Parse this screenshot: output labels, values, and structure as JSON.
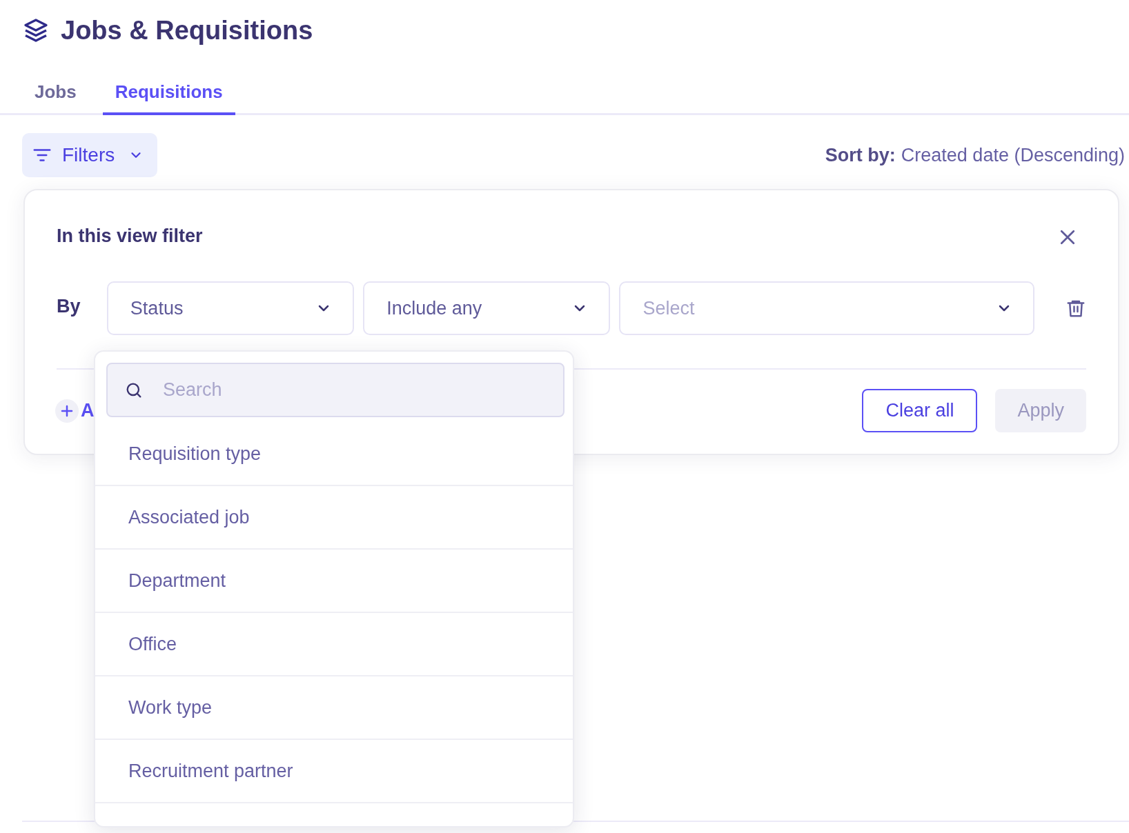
{
  "page": {
    "title": "Jobs & Requisitions"
  },
  "tabs": [
    {
      "label": "Jobs",
      "selected": false
    },
    {
      "label": "Requisitions",
      "selected": true
    }
  ],
  "toolbar": {
    "filters_button": "Filters",
    "sort_label": "Sort by:",
    "sort_value": "Created date (Descending)"
  },
  "filter_panel": {
    "title": "In this view filter",
    "row_label": "By",
    "field": "Status",
    "operator": "Include any",
    "value_placeholder": "Select",
    "add_filter_label": "A",
    "clear_button": "Clear all",
    "apply_button": "Apply",
    "apply_disabled": true
  },
  "field_dropdown": {
    "search_placeholder": "Search",
    "options": [
      "Requisition type",
      "Associated job",
      "Department",
      "Office",
      "Work type",
      "Recruitment partner"
    ]
  }
}
